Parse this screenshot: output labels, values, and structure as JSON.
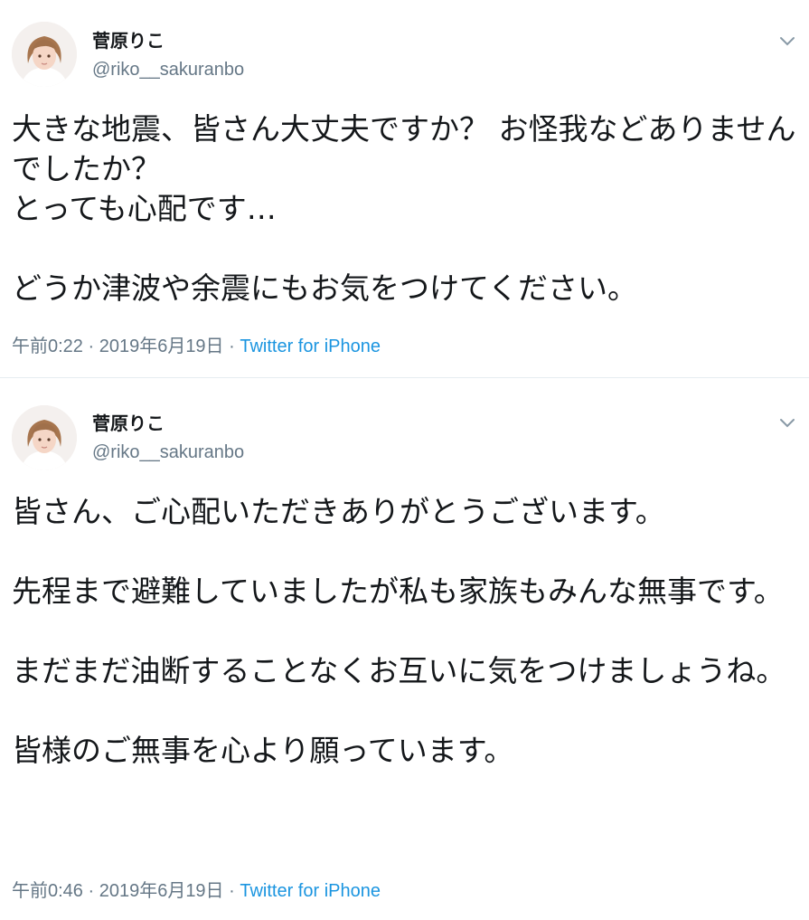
{
  "tweets": [
    {
      "user": {
        "name": "菅原りこ",
        "handle": "@riko__sakuranbo"
      },
      "text": "大きな地震、皆さん大丈夫ですか？ お怪我などありませんでしたか？\nとっても心配です…\n\nどうか津波や余震にもお気をつけてください。",
      "time": "午前0:22 · 2019年6月19日 · ",
      "source": "Twitter for iPhone"
    },
    {
      "user": {
        "name": "菅原りこ",
        "handle": "@riko__sakuranbo"
      },
      "text": "皆さん、ご心配いただきありがとうございます。\n\n先程まで避難していましたが私も家族もみんな無事です。\n\nまだまだ油断することなくお互いに気をつけましょうね。\n\n皆様のご無事を心より願っています。",
      "time": "午前0:46 · 2019年6月19日 · ",
      "source": "Twitter for iPhone"
    }
  ],
  "colors": {
    "text": "#14171a",
    "secondary": "#657786",
    "link": "#1b95e0",
    "divider": "#e6ecf0"
  },
  "icons": {
    "avatar": "profile-photo",
    "menu": "chevron-down-icon"
  }
}
